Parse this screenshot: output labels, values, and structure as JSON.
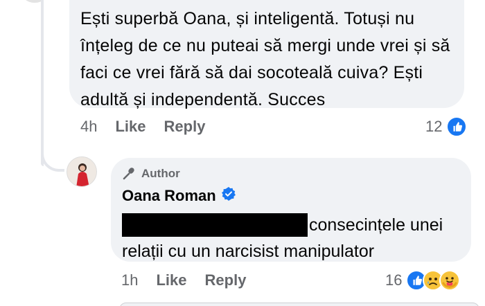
{
  "comment_1": {
    "text": "Ești superbă Oana, și inteligentă. Totuși nu înțeleg de ce nu puteai să mergi unde vrei și să faci ce vrei fără să dai socoteală cuiva? Ești adultă și independentă. Succes",
    "time": "4h",
    "like_label": "Like",
    "reply_label": "Reply",
    "reaction_count": "12",
    "reactions": [
      "like-icon"
    ]
  },
  "comment_2": {
    "author_badge": "Author",
    "author_name": "Oana Roman",
    "text_line1": "consecințele unei",
    "text_line2": "relații cu un narcisist manipulator",
    "time": "1h",
    "like_label": "Like",
    "reply_label": "Reply",
    "reaction_count": "16",
    "reactions": [
      "like-icon",
      "sad-icon",
      "care-icon"
    ]
  },
  "colors": {
    "bubble": "#f0f2f5",
    "meta_text": "#65676b",
    "like_blue": "#1877f2",
    "emoji_yellow": "#f7c33a"
  }
}
